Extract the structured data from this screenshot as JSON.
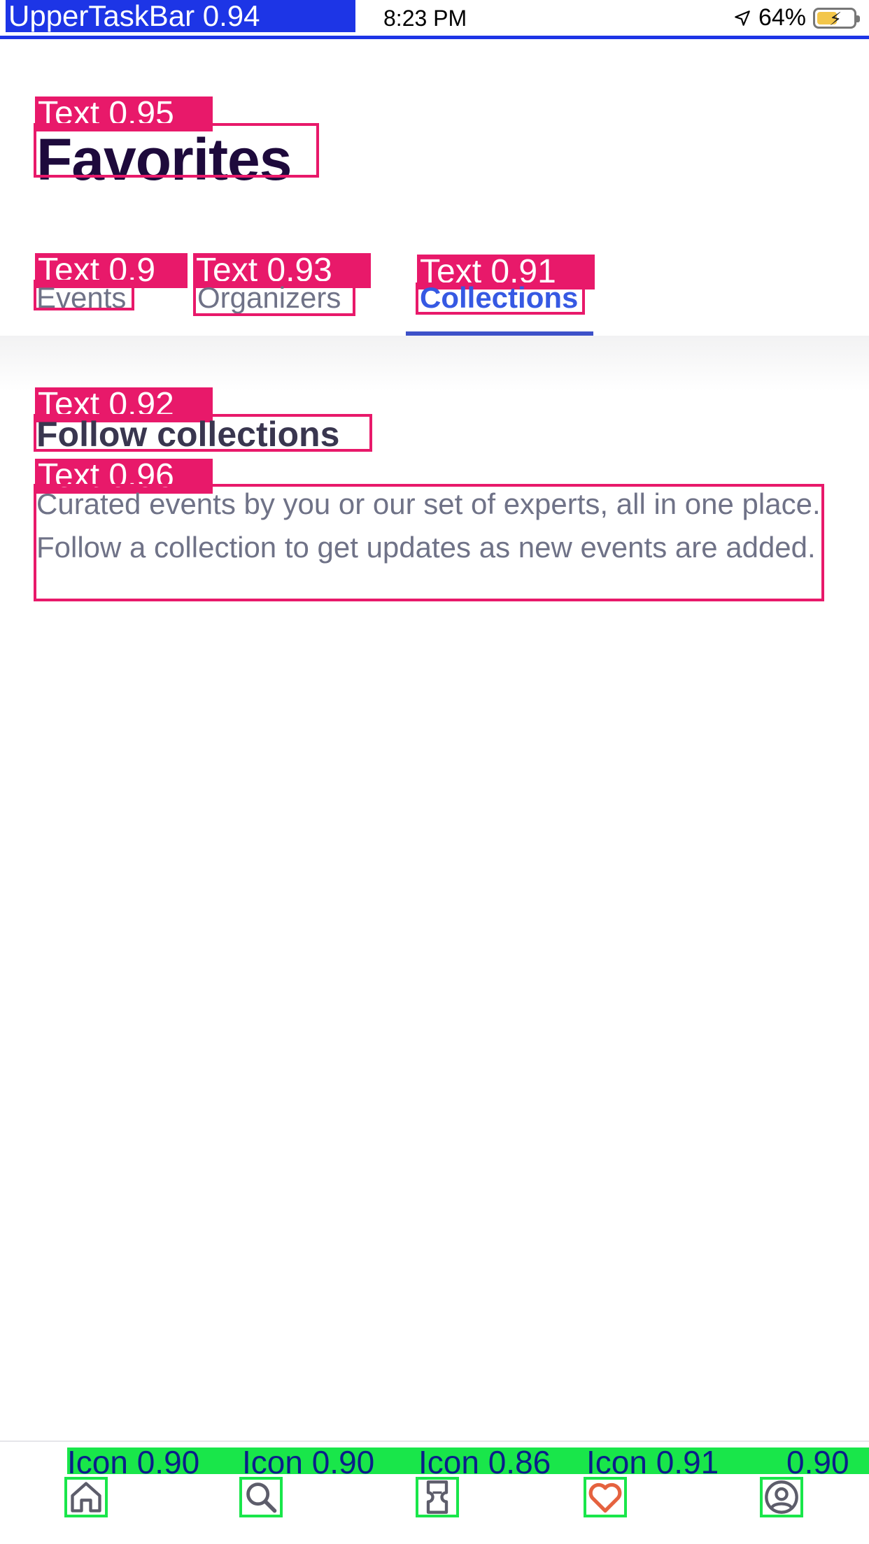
{
  "status_bar": {
    "overlay_label": "UpperTaskBar 0.94",
    "time": "8:23 PM",
    "battery": "64%"
  },
  "overlays": {
    "title_label": "Text 0.95",
    "tab_events_label": "Text 0.9",
    "tab_organizers_label": "Text 0.93",
    "tab_collections_label": "Text 0.91",
    "section_title_label": "Text 0.92",
    "section_desc_label": "Text 0.96"
  },
  "header": {
    "title": "Favorites"
  },
  "tabs": [
    {
      "label": "Events",
      "active": false
    },
    {
      "label": "Organizers",
      "active": false
    },
    {
      "label": "Collections",
      "active": true
    }
  ],
  "main": {
    "section_title": "Follow collections",
    "section_desc": "Curated events by you or our set of experts, all in one place. Follow a collection to get updates as new events are added."
  },
  "bottom_nav": {
    "items": [
      {
        "icon": "home-icon",
        "label": "Icon 0.90",
        "active": false
      },
      {
        "icon": "search-icon",
        "label": "Icon 0.90",
        "active": false
      },
      {
        "icon": "ticket-icon",
        "label": "Icon 0.86",
        "active": false
      },
      {
        "icon": "heart-icon",
        "label": "Icon 0.91",
        "active": true
      },
      {
        "icon": "profile-icon",
        "label": "0.90",
        "active": false
      }
    ]
  },
  "colors": {
    "accent": "#3d51c9",
    "active_icon": "#e5623f",
    "overlay_text": "#e8196a",
    "overlay_icon": "#19e64a",
    "overlay_bar": "#1d35e6"
  }
}
